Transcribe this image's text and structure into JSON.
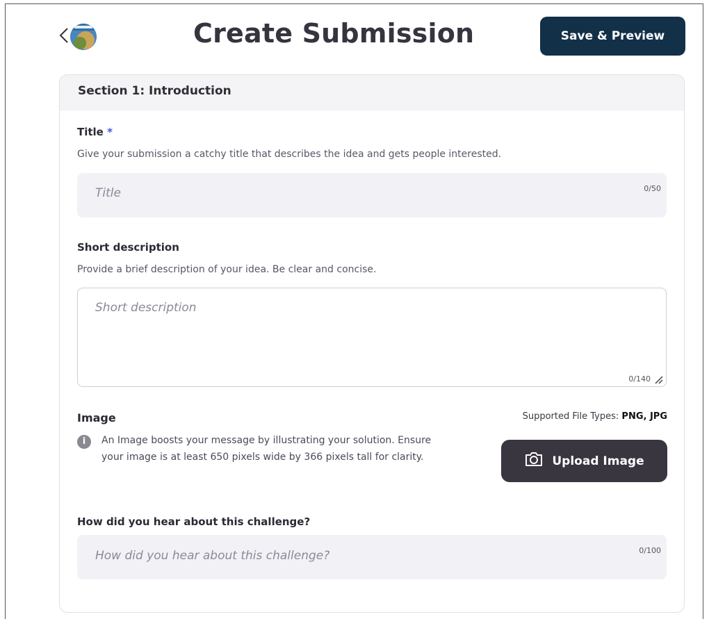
{
  "header": {
    "title": "Create Submission",
    "back_icon": "chevron-left-icon",
    "save_label": "Save & Preview"
  },
  "section": {
    "heading": "Section 1:  Introduction",
    "title_field": {
      "label": "Title",
      "required_mark": "*",
      "hint": "Give your submission a catchy title that describes the idea and gets people interested.",
      "placeholder": "Title",
      "counter": "0/50"
    },
    "short_description": {
      "label": "Short description",
      "hint": "Provide a brief description of your idea. Be clear and concise.",
      "placeholder": "Short description",
      "counter": "0/140"
    },
    "image": {
      "label": "Image",
      "supported_prefix": "Supported File Types: ",
      "supported_types": "PNG, JPG",
      "info_icon": "info-icon",
      "description": "An Image boosts your message by illustrating your solution. Ensure your image is at least 650 pixels wide by 366 pixels tall for clarity.",
      "upload_label": "Upload Image",
      "upload_icon": "camera-icon"
    },
    "hear_about": {
      "label": "How did you hear about this challenge?",
      "placeholder": "How did you hear about this challenge?",
      "counter": "0/100"
    }
  }
}
